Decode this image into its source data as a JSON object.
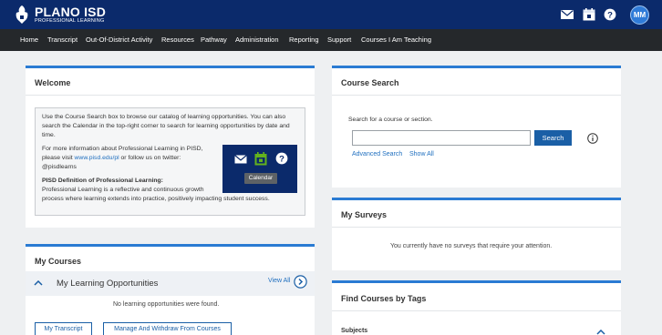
{
  "header": {
    "brand_name": "PLANO ISD",
    "brand_sub": "PROFESSIONAL LEARNING",
    "icons": [
      "mail-icon",
      "calendar-icon",
      "help-icon"
    ],
    "avatar_initials": "MM",
    "colors": {
      "header_bg": "#0b2a6b",
      "nav_bg": "#25282b",
      "accent": "#2a7bd3",
      "button": "#1a5fa6",
      "calendar_green": "#63b21e"
    }
  },
  "nav": {
    "items": [
      "Home",
      "Transcript",
      "Out-Of-District Activity",
      "Resources",
      "Pathway",
      "Administration",
      "Reporting",
      "Support",
      "Courses I Am Teaching"
    ]
  },
  "welcome": {
    "title": "Welcome",
    "p1": "Use the Course Search box to browse our catalog of learning opportunities. You can also search the Calendar in the top-right corner to search for learning opportunities by date and time.",
    "p2_line1": "For more information about Professional Learning in PISD,",
    "p2_line2_pre": "please visit ",
    "p2_link": "www.pisd.edu/pl",
    "p2_line2_post": " or follow us on twitter:",
    "p2_line3": "@pisdlearns",
    "definition_title": "PISD Definition of Professional Learning:",
    "definition_line1": "Professional Learning is a reflective and continuous growth",
    "definition_line2": "process where learning extends into practice, positively impacting student success.",
    "inset_tooltip": "Calendar"
  },
  "course_search": {
    "title": "Course Search",
    "lead": "Search for a course or section.",
    "input_value": "",
    "input_placeholder": "",
    "search_button": "Search",
    "advanced_link": "Advanced Search",
    "show_all_link": "Show All"
  },
  "my_surveys": {
    "title": "My Surveys",
    "message": "You currently have no surveys that require your attention."
  },
  "my_courses": {
    "title": "My Courses",
    "section_title": "My Learning Opportunities",
    "view_all": "View All",
    "empty_message": "No learning opportunities were found.",
    "buttons": [
      "My Transcript",
      "Manage And Withdraw From Courses"
    ]
  },
  "find_by_tags": {
    "title": "Find Courses by Tags",
    "first_group": "Subjects"
  }
}
